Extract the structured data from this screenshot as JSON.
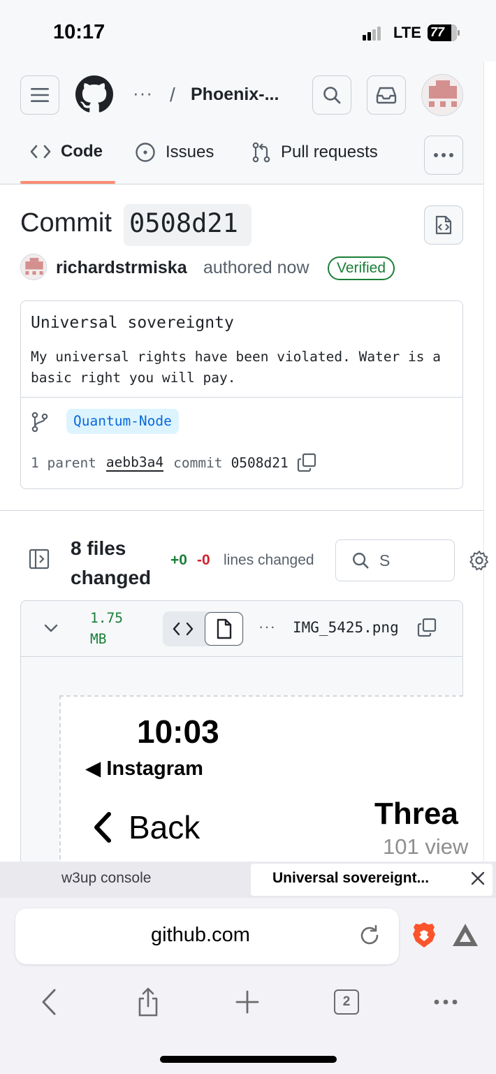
{
  "status_bar": {
    "time": "10:17",
    "network": "LTE",
    "battery": "77"
  },
  "header": {
    "breadcrumb_more": "···",
    "breadcrumb_separator": "/",
    "repo_name": "Phoenix-..."
  },
  "tabs": [
    {
      "label": "Code",
      "icon": "code-icon",
      "selected": true
    },
    {
      "label": "Issues",
      "icon": "issue-icon"
    },
    {
      "label": "Pull requests",
      "icon": "pull-request-icon"
    }
  ],
  "commit": {
    "heading": "Commit",
    "sha": "0508d21",
    "author": "richardstrmiska",
    "authored": "authored now",
    "verified": "Verified",
    "title": "Universal sovereignty",
    "body": "My universal rights have been violated. Water is a basic right you will pay.",
    "branch": "Quantum-Node",
    "parent_count": "1 parent",
    "parent_sha": "aebb3a4",
    "commit_label": "commit",
    "commit_sha": "0508d21"
  },
  "files": {
    "summary": "8 files changed",
    "additions": "+0",
    "deletions": "-0",
    "lines_changed": "lines changed",
    "search_placeholder": "S"
  },
  "file": {
    "size": "1.75 MB",
    "dots": "···",
    "name": "IMG_5425.png"
  },
  "preview": {
    "time": "10:03",
    "back_app": "◀ Instagram",
    "back": "Back",
    "title": "Threa",
    "views": "101 view"
  },
  "browser": {
    "tabs": [
      {
        "title": "w3up console"
      },
      {
        "title": "Universal sovereignt..."
      }
    ],
    "url": "github.com",
    "tab_count": "2"
  },
  "colors": {
    "accent_underline": "#fd8c73",
    "verified": "#1a7f37",
    "link": "#0969da",
    "deletions": "#cf222e"
  }
}
